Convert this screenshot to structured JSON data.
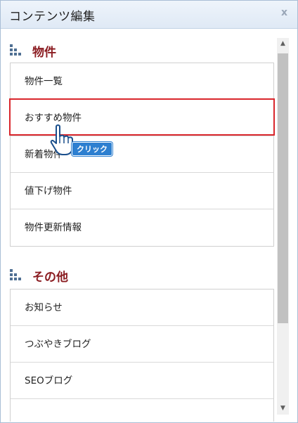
{
  "window": {
    "title": "コンテンツ編集",
    "close_glyph": "x"
  },
  "sections": [
    {
      "title": "物件",
      "items": [
        "物件一覧",
        "おすすめ物件",
        "新着物件",
        "値下げ物件",
        "物件更新情報"
      ]
    },
    {
      "title": "その他",
      "items": [
        "お知らせ",
        "つぶやきブログ",
        "SEOブログ",
        ""
      ]
    }
  ],
  "annotation": {
    "label": "クリック",
    "highlight_color": "#d9262c",
    "badge_color": "#2d7fd0"
  },
  "colors": {
    "section_title": "#8b1d22",
    "section_icon": "#4f6f93"
  },
  "scrollbar": {
    "up_glyph": "▲",
    "down_glyph": "▼"
  }
}
